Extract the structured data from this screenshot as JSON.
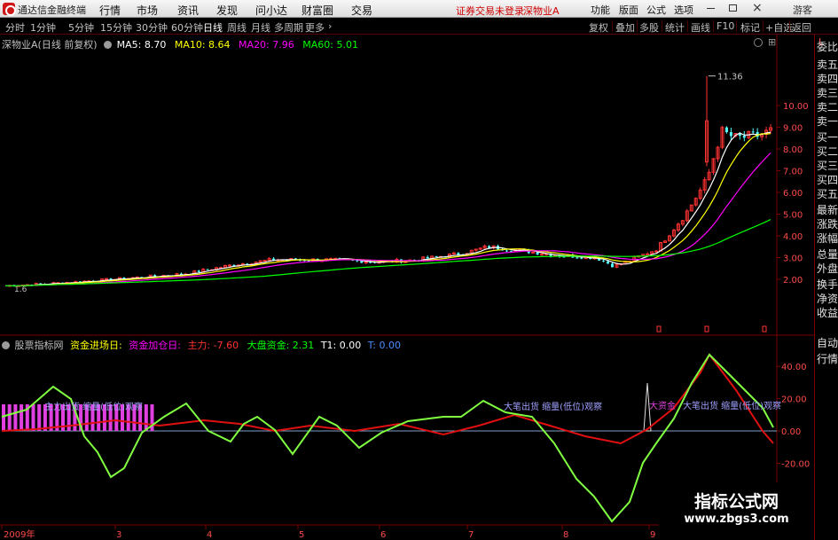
{
  "menubar": {
    "app_title": "通达信金融终端",
    "menus": [
      "行情",
      "市场",
      "资讯",
      "发现",
      "问小达",
      "财富圈",
      "交易"
    ],
    "notice": "证券交易未登录",
    "stock": "深物业A",
    "right_buttons": [
      "功能",
      "版面",
      "公式",
      "选项"
    ],
    "guest": "游客"
  },
  "periodbar": {
    "periods": [
      "分时",
      "1分钟",
      "5分钟",
      "15分钟",
      "30分钟",
      "60分钟",
      "日线",
      "周线",
      "月线",
      "多周期",
      "更多"
    ],
    "active": "日线",
    "more_arrow": "›",
    "right_items": [
      "复权",
      "叠加",
      "多股",
      "统计",
      "画线",
      "F10",
      "标记",
      "+自选",
      "返回"
    ]
  },
  "main_info": {
    "title": "深物业A(日线 前复权)",
    "ma5": "MA5: 8.70",
    "ma10": "MA10: 8.64",
    "ma20": "MA20: 7.96",
    "ma60": "MA60: 5.01",
    "high_label": "11.36",
    "low_label": "1.6"
  },
  "price_axis": [
    "10.00",
    "9.00",
    "8.00",
    "7.00",
    "6.00",
    "5.00",
    "4.00",
    "3.00",
    "2.00"
  ],
  "indicator_info": {
    "name": "股票指标网",
    "jc": "资金进场日:",
    "jc_add": "资金加仓日:",
    "zl": "主力: -7.60",
    "dp": "大盘资金: 2.31",
    "t1": "T1: 0.00",
    "t": "T: 0.00"
  },
  "indicator_axis": [
    "40.00",
    "20.00",
    "0.00",
    "-20.00"
  ],
  "annotations": {
    "a1": "主力出货 缩量(低位)观察",
    "a2": "大笔出货 缩量(低位)观察",
    "a3": "大资金",
    "a4": "大笔出货 缩量(低位)观察"
  },
  "time_axis": [
    "2009年",
    "3",
    "4",
    "5",
    "6",
    "7",
    "8",
    "9"
  ],
  "side_panel": {
    "header": "L",
    "items": [
      "委比",
      "卖五",
      "卖四",
      "卖三",
      "卖二",
      "卖一",
      "买一",
      "买二",
      "买三",
      "买四",
      "买五",
      "最新",
      "涨跌",
      "涨幅",
      "总量",
      "外盘",
      "换手",
      "净资",
      "收益",
      "自动",
      "行情"
    ]
  },
  "watermark": {
    "line1": "指标公式网",
    "line2": "www.zbgs3.com"
  },
  "colors": {
    "up": "#ff3232",
    "down": "#54fcfc",
    "ma5": "#ffffff",
    "ma10": "#ffff00",
    "ma20": "#ff00ff",
    "ma60": "#00ff00",
    "grid": "#7a0000"
  },
  "chart_data": [
    {
      "type": "line",
      "title": "深物业A(日线 前复权)",
      "x": [
        "2009年",
        "3",
        "4",
        "5",
        "6",
        "7",
        "8",
        "9"
      ],
      "series": [
        {
          "name": "MA5",
          "values": [
            1.7,
            2.2,
            2.7,
            2.9,
            2.8,
            3.3,
            3.0,
            8.7
          ]
        },
        {
          "name": "MA10",
          "values": [
            1.7,
            2.1,
            2.6,
            2.9,
            2.8,
            3.2,
            3.0,
            8.64
          ]
        },
        {
          "name": "MA20",
          "values": [
            1.6,
            2.0,
            2.5,
            2.8,
            2.8,
            3.1,
            3.0,
            7.96
          ]
        },
        {
          "name": "MA60",
          "values": [
            1.5,
            1.7,
            2.0,
            2.3,
            2.5,
            2.8,
            3.0,
            5.01
          ]
        }
      ],
      "ylim": [
        1.5,
        11.5
      ]
    },
    {
      "type": "line",
      "series": [
        {
          "name": "主力",
          "values": [
            0,
            3,
            5,
            -4,
            6,
            2,
            -10,
            -7.6
          ]
        },
        {
          "name": "大盘资金",
          "values": [
            22,
            10,
            8,
            -20,
            15,
            12,
            -45,
            2.31
          ]
        }
      ],
      "ylim": [
        -20,
        50
      ]
    }
  ]
}
